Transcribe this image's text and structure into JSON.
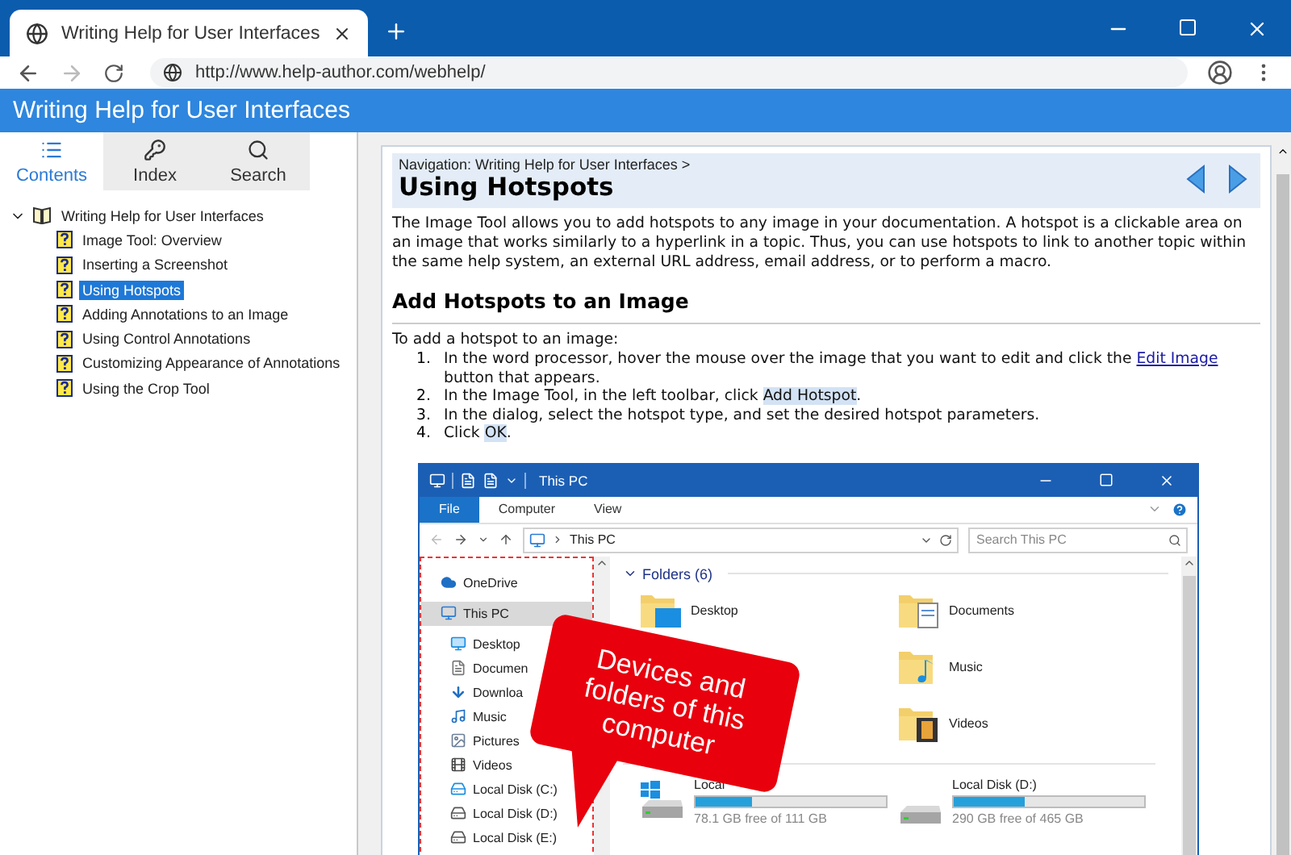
{
  "browser": {
    "tabs": [
      {
        "title": "Writing Help for User Interfaces",
        "selected": true
      }
    ],
    "url": "http://www.help-author.com/webhelp/"
  },
  "app": {
    "title": "Writing Help for User Interfaces"
  },
  "sidebar": {
    "tabs": [
      {
        "label": "Contents",
        "kind": "list",
        "selected": true
      },
      {
        "label": "Index",
        "kind": "key",
        "selected": false
      },
      {
        "label": "Search",
        "kind": "search",
        "selected": false
      }
    ],
    "tree": [
      {
        "label": "Writing Help for User Interfaces",
        "expanded": true,
        "children": [
          {
            "label": "Image Tool: Overview",
            "selected": false
          },
          {
            "label": "Inserting a Screenshot",
            "selected": false
          },
          {
            "label": "Using Hotspots",
            "selected": true
          },
          {
            "label": "Adding Annotations to an Image",
            "selected": false
          },
          {
            "label": "Using Control Annotations",
            "selected": false
          },
          {
            "label": "Customizing Appearance of Annotations",
            "selected": false
          },
          {
            "label": "Using the Crop Tool",
            "selected": false
          }
        ]
      }
    ]
  },
  "topic": {
    "navigation": "Navigation: Writing Help for User Interfaces >",
    "title": "Using Hotspots",
    "intro": "The Image Tool allows you to add hotspots to any image in your documentation. A hotspot is a clickable area on an image that works similarly to a hyperlink in a topic. Thus, you can use hotspots to link to another topic within the same help system, an external URL address, email address, or to perform a macro.",
    "heading": "Add Hotspots to an Image",
    "lead": "To add a hotspot to an image:",
    "steps": [
      {
        "number": "1.",
        "parts": [
          {
            "text": "In the word processor, hover the mouse over the image that you want to edit and click the ",
            "kind": "plain"
          },
          {
            "text": "Edit Image",
            "kind": "link"
          },
          {
            "text": " button that appears.",
            "kind": "plain"
          }
        ]
      },
      {
        "number": "2.",
        "parts": [
          {
            "text": "In the Image Tool, in the left toolbar, click ",
            "kind": "plain"
          },
          {
            "text": "Add Hotspot",
            "kind": "ui"
          },
          {
            "text": ".",
            "kind": "plain"
          }
        ]
      },
      {
        "number": "3.",
        "parts": [
          {
            "text": "In the dialog, select the hotspot type, and set the desired hotspot parameters.",
            "kind": "plain"
          }
        ]
      },
      {
        "number": "4.",
        "parts": [
          {
            "text": "Click ",
            "kind": "plain"
          },
          {
            "text": "OK",
            "kind": "ui"
          },
          {
            "text": ".",
            "kind": "plain"
          }
        ]
      }
    ]
  },
  "screenshot": {
    "title": "This PC",
    "ribbon_tabs": [
      {
        "label": "File",
        "selected": true
      },
      {
        "label": "Computer",
        "selected": false
      },
      {
        "label": "View",
        "selected": false
      }
    ],
    "path": "This PC",
    "search_placeholder": "Search This PC",
    "nav": [
      {
        "label": "OneDrive",
        "kind": "cloud",
        "selected": false
      },
      {
        "label": "This PC",
        "kind": "pc",
        "selected": true
      },
      {
        "label": "Desktop",
        "kind": "desktop",
        "selected": false
      },
      {
        "label": "Documen",
        "kind": "document",
        "selected": false
      },
      {
        "label": "Downloa",
        "kind": "download",
        "selected": false
      },
      {
        "label": "Music",
        "kind": "music",
        "selected": false
      },
      {
        "label": "Pictures",
        "kind": "pictures",
        "selected": false
      },
      {
        "label": "Videos",
        "kind": "videos",
        "selected": false
      },
      {
        "label": "Local Disk (C:)",
        "kind": "system-disk",
        "selected": false
      },
      {
        "label": "Local Disk (D:)",
        "kind": "disk",
        "selected": false
      },
      {
        "label": "Local Disk (E:)",
        "kind": "disk",
        "selected": false
      }
    ],
    "folders_heading": "Folders (6)",
    "folders_left": [
      {
        "label": "Desktop",
        "kind": "desktop"
      }
    ],
    "folders_right": [
      {
        "label": "Documents",
        "kind": "documents"
      },
      {
        "label": "Music",
        "kind": "music"
      },
      {
        "label": "Videos",
        "kind": "videos"
      }
    ],
    "drives": [
      {
        "label": "Local",
        "kind": "system",
        "level": 0.3,
        "free": "78.1 GB free of 111 GB"
      },
      {
        "label": "Local Disk (D:)",
        "kind": "data",
        "level": 0.37,
        "free": "290 GB free of 465 GB"
      }
    ],
    "callout": "Devices and folders of this computer"
  }
}
